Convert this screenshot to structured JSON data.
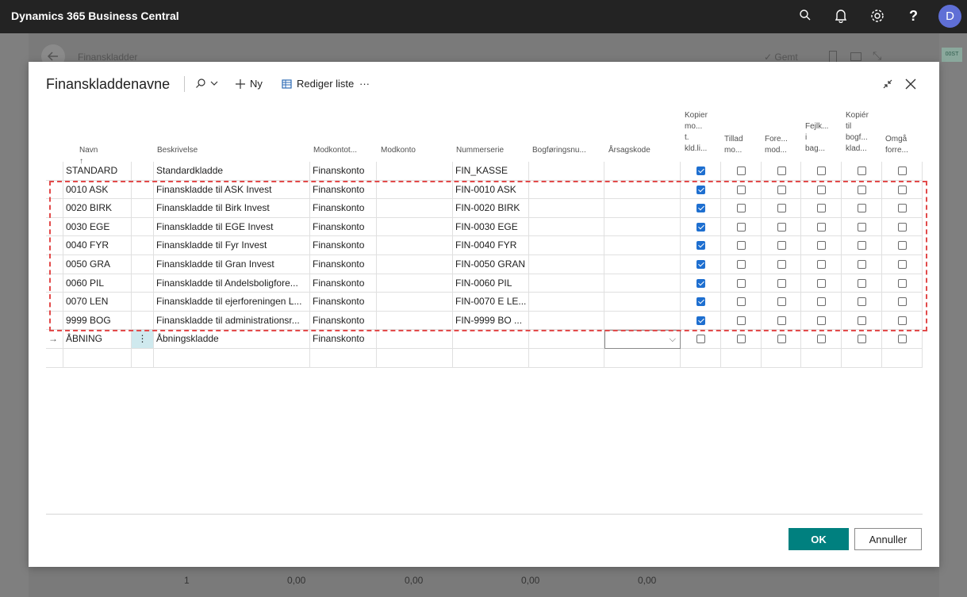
{
  "app": {
    "title": "Dynamics 365 Business Central",
    "avatar_letter": "D"
  },
  "background": {
    "page_title": "Finanskladder",
    "saved_label": "Gemt",
    "tag": "00ST",
    "bottom_values": [
      "1",
      "0,00",
      "0,00",
      "0,00",
      "0,00"
    ]
  },
  "dialog": {
    "title": "Finanskladdenavne",
    "new_label": "Ny",
    "edit_list_label": "Rediger liste",
    "more_label": "···",
    "ok_label": "OK",
    "cancel_label": "Annuller"
  },
  "columns": {
    "navn": "Navn",
    "beskrivelse": "Beskrivelse",
    "modkontotype": "Modkontot...",
    "modkonto": "Modkonto",
    "nummerserie": "Nummerserie",
    "bogforingsnr": "Bogføringsnu...",
    "arsagskode": "Årsagskode",
    "kopier_line1": "Kopier",
    "kopier_line2": "mo...",
    "kopier_line3": "t.",
    "kopier_line4": "kld.li...",
    "tillad_line1": "Tillad",
    "tillad_line2": "mo...",
    "fore_line1": "Fore...",
    "fore_line2": "mod...",
    "fejl_line1": "Fejlk...",
    "fejl_line2": "i",
    "fejl_line3": "bag...",
    "kopierbog_line1": "Kopiér",
    "kopierbog_line2": "til",
    "kopierbog_line3": "bogf...",
    "kopierbog_line4": "klad...",
    "omga_line1": "Omgå",
    "omga_line2": "forre..."
  },
  "rows": [
    {
      "navn": "STANDARD",
      "beskrivelse": "Standardkladde",
      "modkontotype": "Finanskonto",
      "nummerserie": "FIN_KASSE",
      "kopier": true
    },
    {
      "navn": "0010 ASK",
      "beskrivelse": "Finanskladde til ASK Invest",
      "modkontotype": "Finanskonto",
      "nummerserie": "FIN-0010 ASK",
      "kopier": true
    },
    {
      "navn": "0020 BIRK",
      "beskrivelse": "Finanskladde til Birk Invest",
      "modkontotype": "Finanskonto",
      "nummerserie": "FIN-0020 BIRK",
      "kopier": true
    },
    {
      "navn": "0030 EGE",
      "beskrivelse": "Finanskladde til EGE Invest",
      "modkontotype": "Finanskonto",
      "nummerserie": "FIN-0030 EGE",
      "kopier": true
    },
    {
      "navn": "0040 FYR",
      "beskrivelse": "Finanskladde til Fyr Invest",
      "modkontotype": "Finanskonto",
      "nummerserie": "FIN-0040 FYR",
      "kopier": true
    },
    {
      "navn": "0050 GRA",
      "beskrivelse": "Finanskladde til Gran Invest",
      "modkontotype": "Finanskonto",
      "nummerserie": "FIN-0050 GRAN",
      "kopier": true
    },
    {
      "navn": "0060 PIL",
      "beskrivelse": "Finanskladde til Andelsboligfore...",
      "modkontotype": "Finanskonto",
      "nummerserie": "FIN-0060 PIL",
      "kopier": true
    },
    {
      "navn": "0070 LEN",
      "beskrivelse": "Finanskladde til ejerforeningen L...",
      "modkontotype": "Finanskonto",
      "nummerserie": "FIN-0070 E LE...",
      "kopier": true
    },
    {
      "navn": "9999 BOG",
      "beskrivelse": "Finanskladde til administrationsr...",
      "modkontotype": "Finanskonto",
      "nummerserie": "FIN-9999 BO ...",
      "kopier": true
    },
    {
      "navn": "ÅBNING",
      "beskrivelse": "Åbningskladde",
      "modkontotype": "Finanskonto",
      "nummerserie": "",
      "kopier": false
    }
  ]
}
